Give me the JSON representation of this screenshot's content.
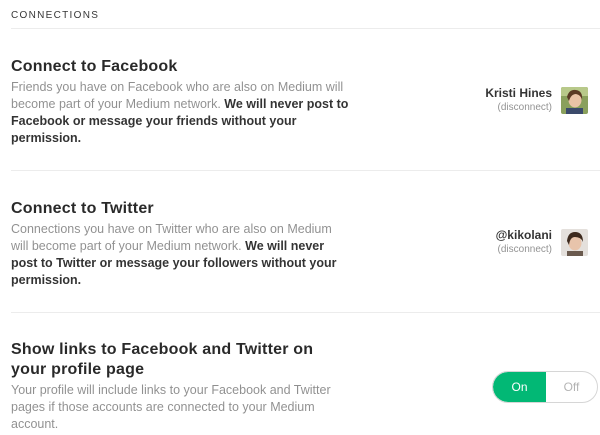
{
  "section": {
    "title": "CONNECTIONS"
  },
  "facebook": {
    "title": "Connect to Facebook",
    "desc_plain": "Friends you have on Facebook who are also on Medium will become part of your Medium network. ",
    "desc_strong": "We will never post to Facebook or message your friends without your permission.",
    "account_name": "Kristi Hines",
    "disconnect_label": "(disconnect)"
  },
  "twitter": {
    "title": "Connect to Twitter",
    "desc_plain": "Connections you have on Twitter who are also on Medium will become part of your Medium network. ",
    "desc_strong": "We will never post to Twitter or message your followers without your permission.",
    "account_name": "@kikolani",
    "disconnect_label": "(disconnect)"
  },
  "profile_links": {
    "title": "Show links to Facebook and Twitter on your profile page",
    "desc": "Your profile will include links to your Facebook and Twitter pages if those accounts are connected to your Medium account.",
    "toggle_on_label": "On",
    "toggle_off_label": "Off",
    "toggle_state": "on"
  },
  "colors": {
    "accent_green": "#02b875",
    "divider": "#ececec"
  },
  "icons": {
    "facebook_avatar": "user-avatar-photo",
    "twitter_avatar": "user-avatar-photo"
  }
}
